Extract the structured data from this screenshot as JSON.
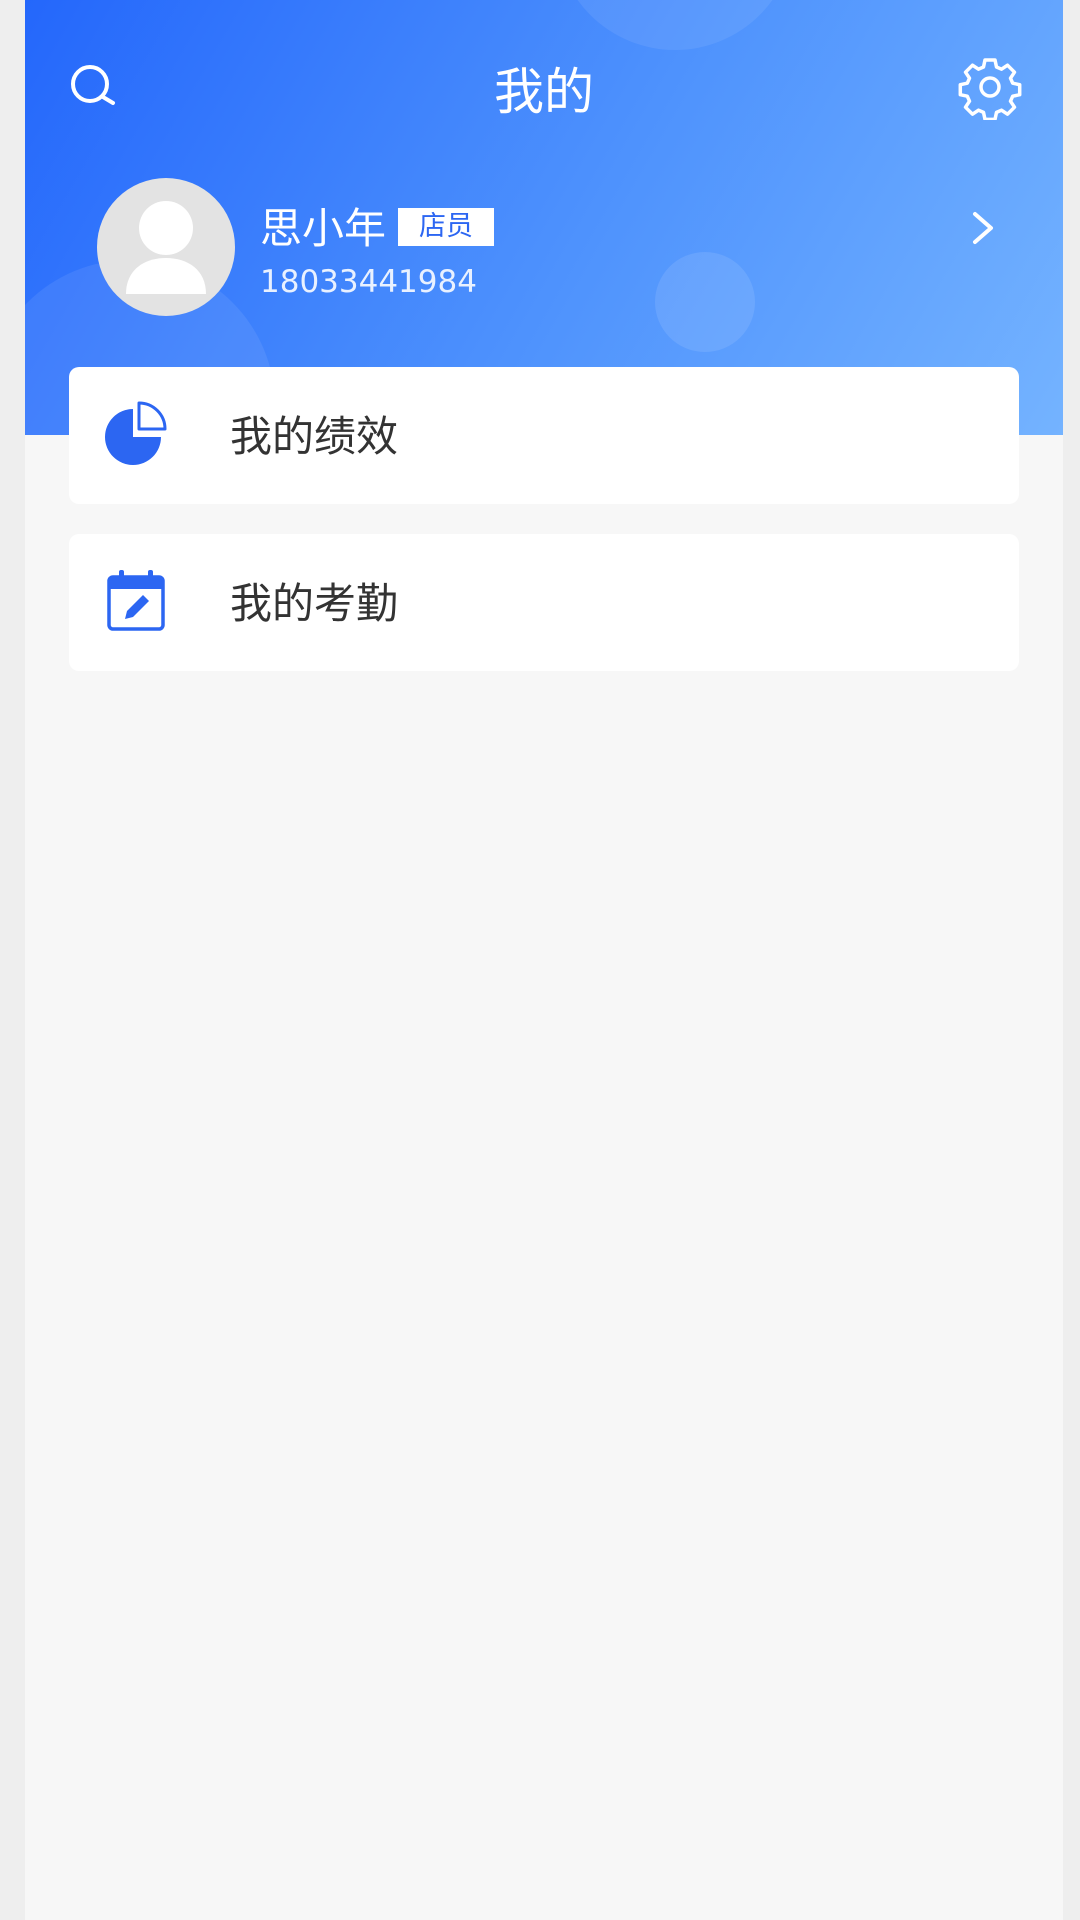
{
  "header": {
    "title": "我的"
  },
  "profile": {
    "name": "思小年",
    "role_badge": "店员",
    "phone": "18033441984"
  },
  "menu": {
    "items": [
      {
        "label": "我的绩效",
        "icon": "pie-chart-icon"
      },
      {
        "label": "我的考勤",
        "icon": "calendar-edit-icon"
      }
    ]
  },
  "icons": {
    "top_left": "search-icon",
    "top_right": "gear-icon",
    "profile_arrow": "chevron-right-icon",
    "avatar": "user-silhouette-icon"
  },
  "colors": {
    "header_gradient_start": "#2467fb",
    "header_gradient_end": "#74b3ff",
    "accent": "#2c66f2",
    "page_background": "#f7f7f7",
    "card_background": "#ffffff",
    "text_primary": "#333333"
  }
}
